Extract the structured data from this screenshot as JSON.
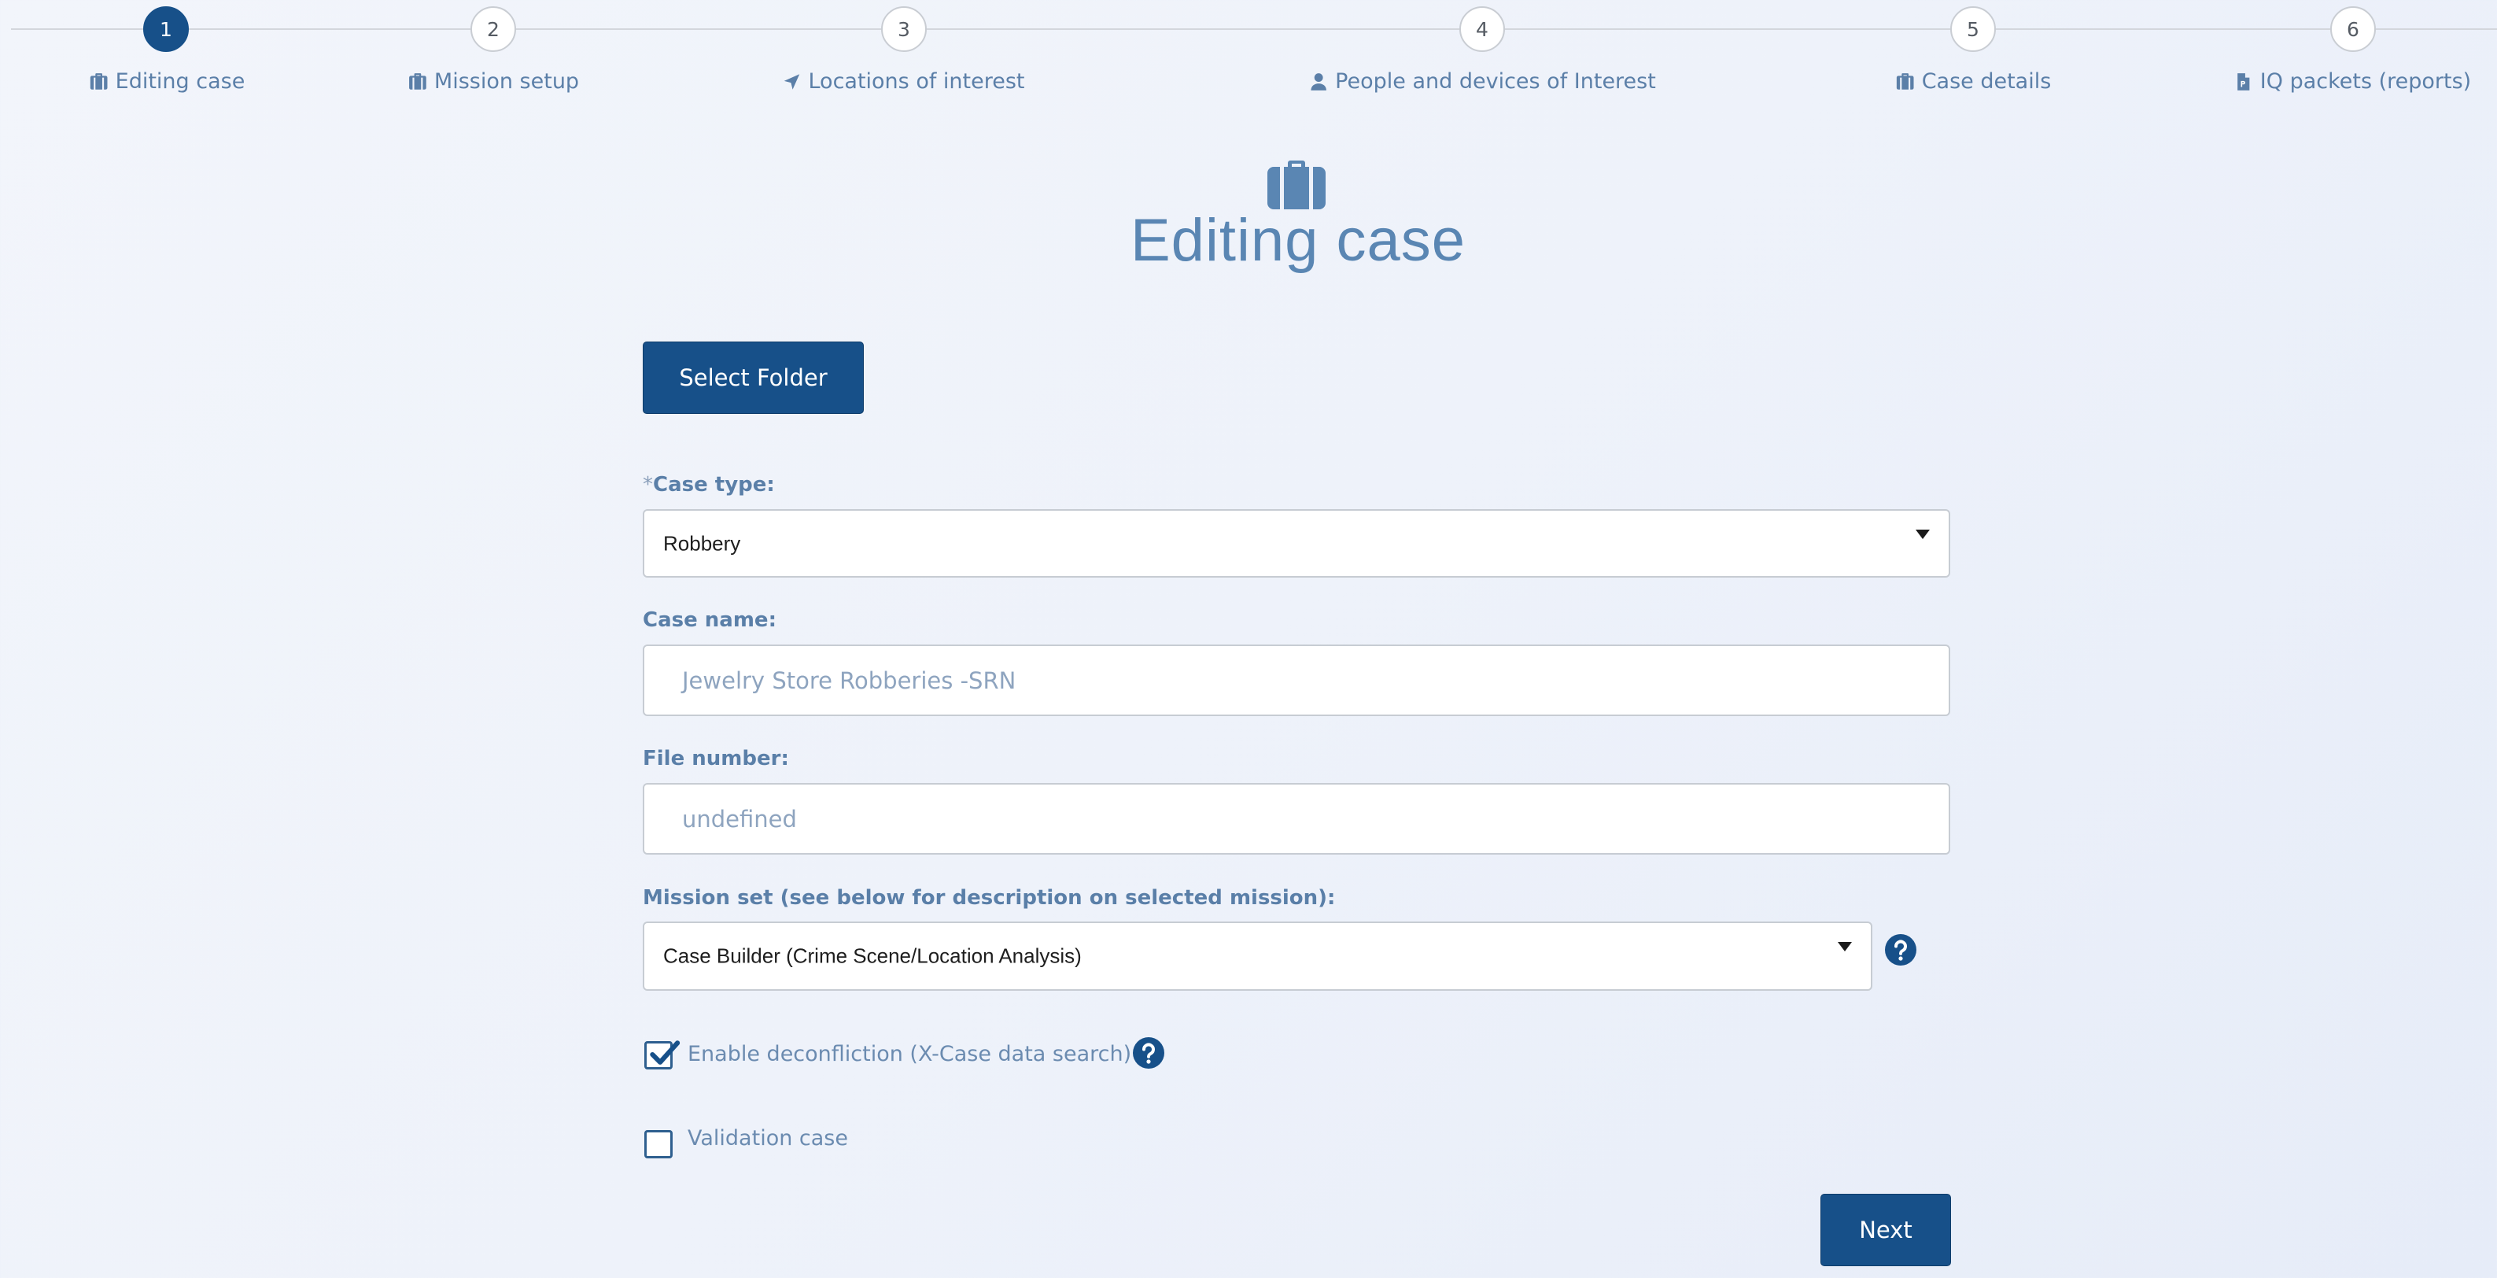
{
  "stepper": {
    "steps": [
      {
        "number": "1",
        "label": "Editing case",
        "icon": "briefcase-icon",
        "active": true
      },
      {
        "number": "2",
        "label": "Mission setup",
        "icon": "briefcase-icon",
        "active": false
      },
      {
        "number": "3",
        "label": "Locations of interest",
        "icon": "location-arrow-icon",
        "active": false
      },
      {
        "number": "4",
        "label": "People and devices of Interest",
        "icon": "user-icon",
        "active": false
      },
      {
        "number": "5",
        "label": "Case details",
        "icon": "briefcase-icon",
        "active": false
      },
      {
        "number": "6",
        "label": "IQ packets (reports)",
        "icon": "file-icon",
        "active": false
      }
    ]
  },
  "page": {
    "icon": "briefcase-icon",
    "title": "Editing case"
  },
  "actions": {
    "select_folder_label": "Select Folder",
    "next_label": "Next"
  },
  "form": {
    "case_type": {
      "required_marker": "*",
      "label": "Case type:",
      "value": "Robbery"
    },
    "case_name": {
      "label": "Case name:",
      "value": "Jewelry Store Robberies -SRN"
    },
    "file_number": {
      "label": "File number:",
      "value": "undefined"
    },
    "mission_set": {
      "label": "Mission set (see below for description on selected mission):",
      "value": "Case Builder (Crime Scene/Location Analysis)"
    },
    "enable_deconfliction": {
      "label": "Enable deconfliction (X-Case data search)",
      "checked": true
    },
    "validation_case": {
      "label": "Validation case",
      "checked": false
    }
  },
  "colors": {
    "primary": "#175089",
    "label_text": "#5a7fa8",
    "background": "#eef2fa"
  }
}
